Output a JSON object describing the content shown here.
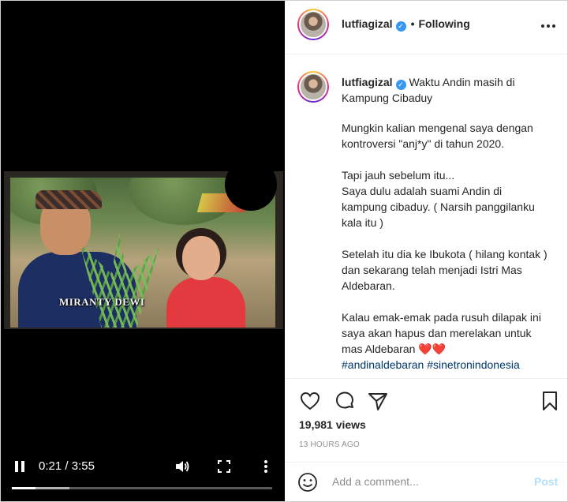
{
  "video": {
    "overlay_caption": "MIRANTY DEWI",
    "current_time": "0:21",
    "separator": " / ",
    "duration": "3:55",
    "progress": 0.09,
    "buffered": 0.22,
    "icons": {
      "pause": "pause-icon",
      "volume": "volume-icon",
      "fullscreen": "fullscreen-icon",
      "more": "more-vertical-icon"
    }
  },
  "header": {
    "username": "lutfiagizal",
    "separator": "•",
    "follow_status": "Following"
  },
  "post": {
    "username": "lutfiagizal",
    "caption_first": "Waktu Andin masih di Kampung Cibaduy",
    "paragraphs": [
      "Mungkin kalian mengenal saya dengan kontroversi \"anj*y\" di tahun 2020.",
      "Tapi jauh sebelum itu...\nSaya dulu adalah suami Andin di kampung cibaduy. ( Narsih panggilanku kala itu )",
      "Setelah itu dia ke Ibukota ( hilang kontak ) dan sekarang telah menjadi Istri Mas Aldebaran.",
      "Kalau emak-emak pada rusuh dilapak ini saya akan hapus dan merelakan untuk mas Aldebaran ❤️❤️"
    ],
    "hashtags": [
      "#andinaldebaran",
      "#sinetronindonesia"
    ]
  },
  "stats": {
    "views": "19,981 views",
    "time_ago": "13 HOURS AGO"
  },
  "comment": {
    "placeholder": "Add a comment...",
    "post_label": "Post"
  },
  "colors": {
    "accent": "#3897f0",
    "post_disabled": "#b2dffc",
    "hashtag": "#00376b",
    "text": "#262626",
    "muted": "#8e8e8e"
  }
}
